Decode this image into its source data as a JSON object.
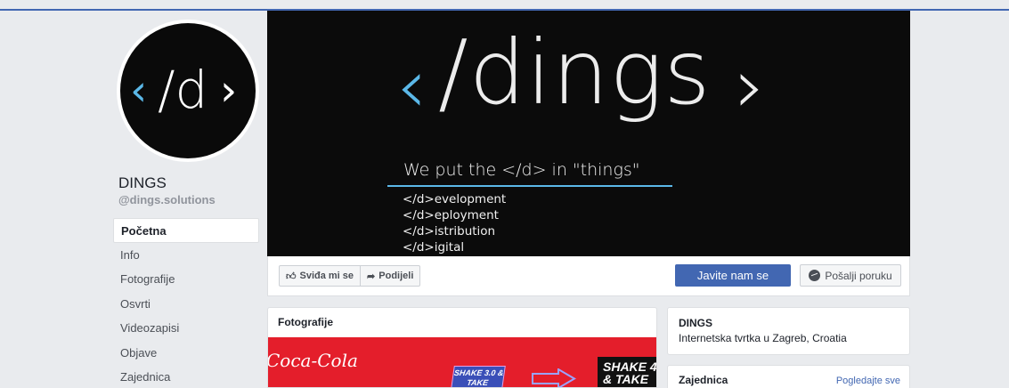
{
  "page": {
    "name": "DINGS",
    "handle": "@dings.solutions",
    "avatar_text": {
      "lt": "‹",
      "mid": "/d",
      "gt": "›"
    }
  },
  "nav": {
    "items": [
      {
        "label": "Početna",
        "active": true
      },
      {
        "label": "Info"
      },
      {
        "label": "Fotografije"
      },
      {
        "label": "Osvrti"
      },
      {
        "label": "Videozapisi"
      },
      {
        "label": "Objave"
      },
      {
        "label": "Zajednica"
      }
    ]
  },
  "cover": {
    "lt": "‹",
    "word": "/dings",
    "gt": "›",
    "tagline": "We put the </d> in \"things\"",
    "lines": [
      "</d>evelopment",
      "</d>eployment",
      "</d>istribution",
      "</d>igital"
    ]
  },
  "actions": {
    "like_label": "Sviđa mi se",
    "share_label": "Podijeli",
    "contact_label": "Javite nam se",
    "message_label": "Pošalji poruku"
  },
  "photos": {
    "title": "Fotografije",
    "brand_text": "Coca-Cola",
    "promo1": "SHAKE 3.0 & TAKE",
    "promo2": "SHAKE 4 & TAKE"
  },
  "about": {
    "name": "DINGS",
    "description": "Internetska tvrtka u Zagreb, Croatia"
  },
  "community": {
    "title": "Zajednica",
    "see_all": "Pogledajte sve"
  },
  "colors": {
    "accent": "#4267b2",
    "brand_blue": "#5bb8e8",
    "background": "#e9ebee",
    "cover_bg": "#0b0b0b"
  },
  "icons": {
    "like": "thumbs-up-icon",
    "share": "share-arrow-icon",
    "message": "messenger-icon"
  }
}
